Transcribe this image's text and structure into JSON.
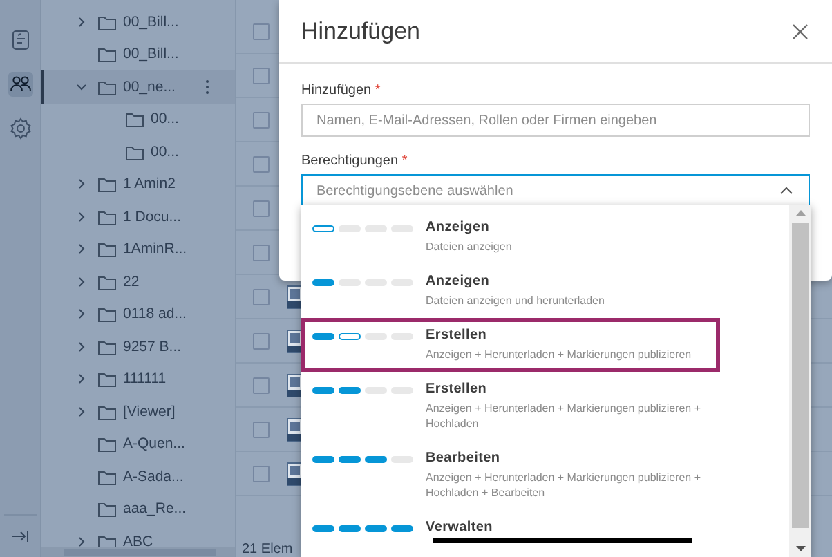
{
  "rail": {
    "items": [
      {
        "kind": "checklist",
        "selected": false
      },
      {
        "kind": "people",
        "selected": true
      },
      {
        "kind": "settings",
        "selected": false
      }
    ]
  },
  "tree": {
    "items": [
      {
        "label": "00_Bill...",
        "expanded": false,
        "selected": false
      },
      {
        "label": "00_Bill...",
        "selected": false
      },
      {
        "label": "00_ne...",
        "expanded": true,
        "selected": true,
        "children": [
          {
            "label": "00...",
            "selected": false
          },
          {
            "label": "00...",
            "selected": false
          }
        ]
      },
      {
        "label": "1 Amin2",
        "expanded": false,
        "selected": false
      },
      {
        "label": "1 Docu...",
        "expanded": false,
        "selected": false
      },
      {
        "label": "1AminR...",
        "expanded": false,
        "selected": false
      },
      {
        "label": "22",
        "expanded": false,
        "selected": false
      },
      {
        "label": "0118 ad...",
        "expanded": false,
        "selected": false
      },
      {
        "label": "9257 B...",
        "expanded": false,
        "selected": false
      },
      {
        "label": "111111",
        "expanded": false,
        "selected": false
      },
      {
        "label": "[Viewer]",
        "expanded": false,
        "selected": false
      },
      {
        "label": "A-Quen...",
        "selected": false
      },
      {
        "label": "A-Sada...",
        "selected": false
      },
      {
        "label": "aaa_Re...",
        "selected": false
      },
      {
        "label": "ABC",
        "expanded": false,
        "selected": false
      }
    ]
  },
  "list": {
    "rows": [
      {
        "kind": "plain",
        "checked": false
      },
      {
        "kind": "plain",
        "checked": false
      },
      {
        "kind": "plain",
        "checked": false
      },
      {
        "kind": "plain",
        "checked": false
      },
      {
        "kind": "plain",
        "checked": false
      },
      {
        "kind": "plain",
        "checked": false
      },
      {
        "kind": "file",
        "checked": false
      },
      {
        "kind": "file",
        "checked": false
      },
      {
        "kind": "file",
        "checked": false
      },
      {
        "kind": "file",
        "checked": false
      },
      {
        "kind": "file",
        "checked": false
      }
    ],
    "status": "21 Elem"
  },
  "dialog": {
    "title": "Hinzufügen",
    "fields": [
      {
        "label": "Hinzufügen",
        "required_mark": "*",
        "placeholder": "Namen, E-Mail-Adressen, Rollen oder Firmen eingeben",
        "focused": false
      },
      {
        "label": "Berechtigungen",
        "required_mark": "*",
        "placeholder": "Berechtigungsebene auswählen",
        "focused": true
      }
    ],
    "options": [
      {
        "title": "Anzeigen",
        "description": "Dateien anzeigen",
        "pills": [
          {
            "filled": false,
            "outlined": true
          },
          {
            "filled": false,
            "outlined": false
          },
          {
            "filled": false,
            "outlined": false
          },
          {
            "filled": false,
            "outlined": false
          }
        ],
        "highlighted": false
      },
      {
        "title": "Anzeigen",
        "description": "Dateien anzeigen und herunterladen",
        "pills": [
          {
            "filled": true
          },
          {
            "filled": false,
            "outlined": false
          },
          {
            "filled": false,
            "outlined": false
          },
          {
            "filled": false,
            "outlined": false
          }
        ],
        "highlighted": false
      },
      {
        "title": "Erstellen",
        "description": "Anzeigen + Herunterladen + Markierungen publizieren",
        "pills": [
          {
            "filled": true
          },
          {
            "filled": false,
            "outlined": true
          },
          {
            "filled": false,
            "outlined": false
          },
          {
            "filled": false,
            "outlined": false
          }
        ],
        "highlighted": true
      },
      {
        "title": "Erstellen",
        "description": "Anzeigen + Herunterladen + Markierungen publizieren + Hochladen",
        "pills": [
          {
            "filled": true
          },
          {
            "filled": true
          },
          {
            "filled": false,
            "outlined": false
          },
          {
            "filled": false,
            "outlined": false
          }
        ],
        "highlighted": false
      },
      {
        "title": "Bearbeiten",
        "description": "Anzeigen + Herunterladen + Markierungen publizieren + Hochladen + Bearbeiten",
        "pills": [
          {
            "filled": true
          },
          {
            "filled": true
          },
          {
            "filled": true
          },
          {
            "filled": false,
            "outlined": false
          }
        ],
        "highlighted": false
      },
      {
        "title": "Verwalten",
        "pills": [
          {
            "filled": true
          },
          {
            "filled": true
          },
          {
            "filled": true
          },
          {
            "filled": true
          }
        ],
        "highlighted": false
      }
    ]
  }
}
